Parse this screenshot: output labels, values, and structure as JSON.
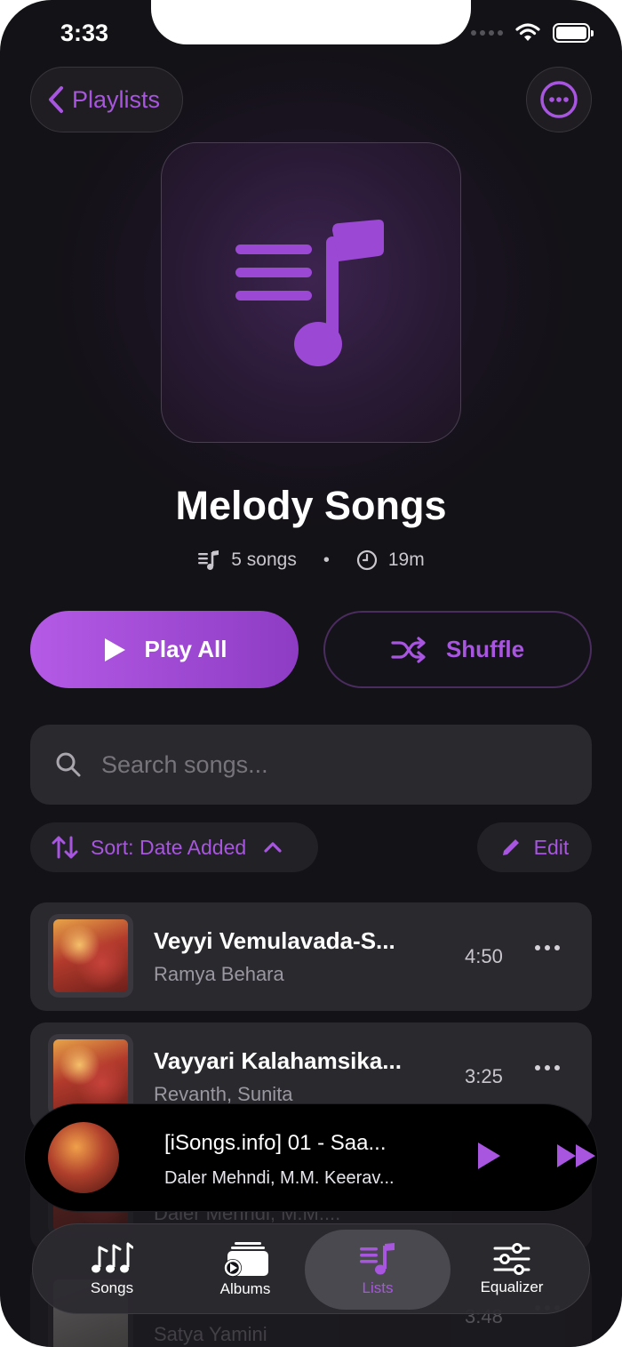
{
  "status_bar": {
    "time": "3:33"
  },
  "header": {
    "back_label": "Playlists"
  },
  "playlist": {
    "title": "Melody Songs",
    "song_count": "5 songs",
    "duration": "19m",
    "separator": "•"
  },
  "actions": {
    "play_all": "Play All",
    "shuffle": "Shuffle"
  },
  "search": {
    "placeholder": "Search songs..."
  },
  "toolbar": {
    "sort_label": "Sort: Date Added",
    "edit_label": "Edit"
  },
  "songs": [
    {
      "title": "Veyyi Vemulavada-S...",
      "artist": "Ramya Behara",
      "duration": "4:50"
    },
    {
      "title": "Vayyari Kalahamsika...",
      "artist": "Revanth, Sunita",
      "duration": "3:25"
    },
    {
      "title": "",
      "artist": "Daler Mehndi, M.M....",
      "duration": ""
    },
    {
      "title": "",
      "artist": "Satya Yamini",
      "duration": "3:48"
    }
  ],
  "now_playing": {
    "title": "[iSongs.info] 01 - Saa...",
    "artist": "Daler Mehndi, M.M. Keerav..."
  },
  "tabs": [
    {
      "label": "Songs",
      "icon": "music-notes-icon"
    },
    {
      "label": "Albums",
      "icon": "albums-icon"
    },
    {
      "label": "Lists",
      "icon": "playlist-icon",
      "active": true
    },
    {
      "label": "Equalizer",
      "icon": "equalizer-icon"
    }
  ],
  "colors": {
    "accent": "#a855e0",
    "background": "#131216",
    "card": "#2a292e"
  }
}
